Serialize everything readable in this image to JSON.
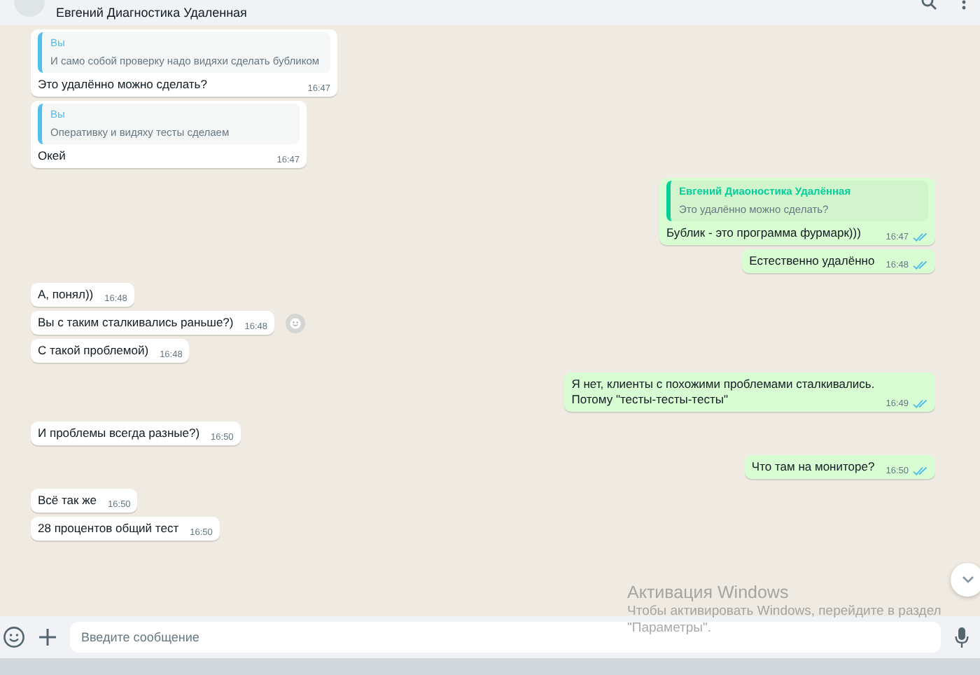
{
  "header": {
    "title": "Евгений Диагностика Удаленная"
  },
  "groups": [
    {
      "outgoing": false,
      "messages": [
        {
          "quote": {
            "author": "Вы",
            "text": "И само собой проверку надо видяхи сделать бубликом"
          },
          "text": "Это удалённо можно сделать?",
          "time": "16:47"
        },
        {
          "quote": {
            "author": "Вы",
            "text": "Оперативку и видяху тесты сделаем"
          },
          "text": "Окей",
          "time": "16:47"
        }
      ]
    },
    {
      "outgoing": true,
      "messages": [
        {
          "quote": {
            "author": "Евгений Диаоностика Удалённая",
            "text": "Это удалённо можно сделать?"
          },
          "text": "Бублик - это программа фурмарк)))",
          "time": "16:47",
          "read": true
        },
        {
          "text": "Естественно удалённо",
          "time": "16:48",
          "read": true
        }
      ]
    },
    {
      "outgoing": false,
      "messages": [
        {
          "text": "А, понял))",
          "time": "16:48"
        },
        {
          "text": "Вы с таким сталкивались раньше?)",
          "time": "16:48",
          "reaction_button": true
        },
        {
          "text": "С такой проблемой)",
          "time": "16:48"
        }
      ]
    },
    {
      "outgoing": true,
      "messages": [
        {
          "text": "Я нет, клиенты с похожими проблемами сталкивались.\nПотому \"тесты-тесты-тесты\"",
          "time": "16:49",
          "read": true
        }
      ]
    },
    {
      "outgoing": false,
      "messages": [
        {
          "text": "И проблемы всегда разные?)",
          "time": "16:50"
        }
      ]
    },
    {
      "outgoing": true,
      "messages": [
        {
          "text": "Что там на мониторе?",
          "time": "16:50",
          "read": true
        }
      ]
    },
    {
      "outgoing": false,
      "messages": [
        {
          "text": "Всё так же",
          "time": "16:50"
        },
        {
          "text": "28 процентов общий тест",
          "time": "16:50"
        }
      ]
    }
  ],
  "composer": {
    "placeholder": "Введите сообщение"
  },
  "windows_activation": {
    "title": "Активация Windows",
    "lines": [
      "Чтобы активировать Windows, перейдите в раздел",
      "\"Параметры\"."
    ]
  }
}
